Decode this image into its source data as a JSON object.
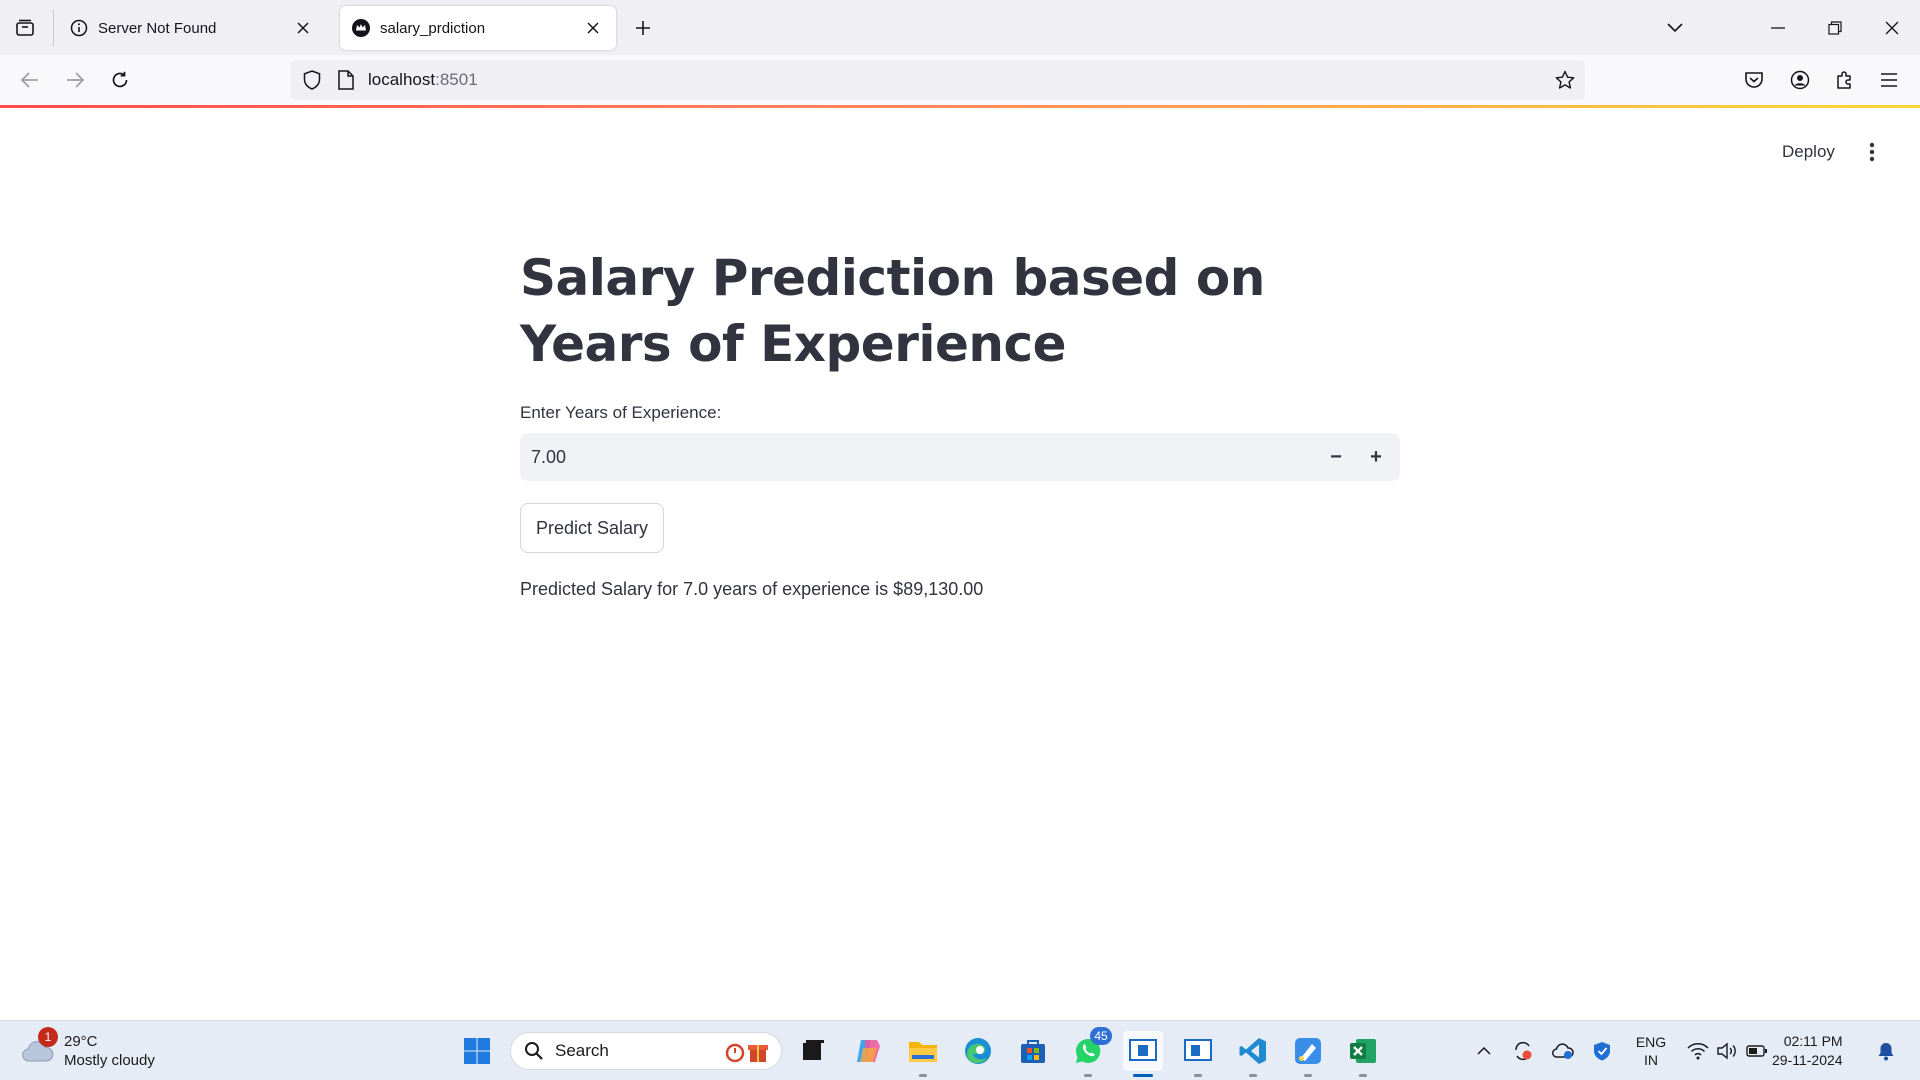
{
  "browser": {
    "tabs": [
      {
        "title": "Server Not Found",
        "favicon": "info-icon",
        "active": false
      },
      {
        "title": "salary_prdiction",
        "favicon": "streamlit-crown-icon",
        "active": true
      }
    ],
    "url": {
      "host": "localhost",
      "port": ":8501"
    }
  },
  "app": {
    "deploy_label": "Deploy",
    "title": "Salary Prediction based on Years of Experience",
    "input_label": "Enter Years of Experience:",
    "input_value": "7.00",
    "minus_label": "−",
    "plus_label": "+",
    "button_label": "Predict Salary",
    "result_text": "Predicted Salary for 7.0 years of experience is $89,130.00"
  },
  "taskbar": {
    "weather": {
      "badge": "1",
      "temp": "29°C",
      "condition": "Mostly cloudy"
    },
    "search_label": "Search",
    "whatsapp_badge": "45",
    "language": {
      "line1": "ENG",
      "line2": "IN"
    },
    "clock": {
      "time": "02:11 PM",
      "date": "29-11-2024"
    }
  },
  "colors": {
    "accent": "#ff4b4b",
    "text": "#31333f",
    "input_bg": "#f0f2f6"
  }
}
